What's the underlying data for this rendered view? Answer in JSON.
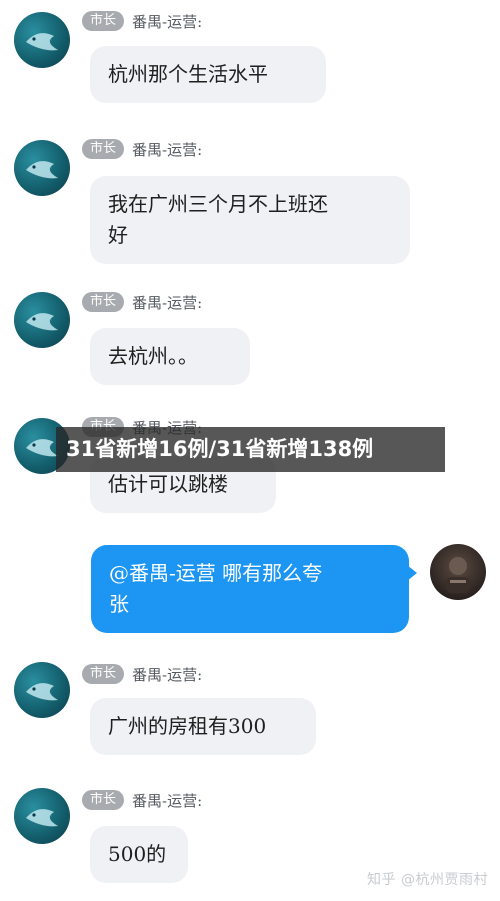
{
  "overlay_headline": "31省新增16例/31省新增138例",
  "watermark": "知乎 @杭州贾雨村",
  "messages": [
    {
      "sender_role": "市长",
      "sender_name": "番禺-运营:",
      "text": "杭州那个生活水平"
    },
    {
      "sender_role": "市长",
      "sender_name": "番禺-运营:",
      "text_lines": [
        "我在广州三个月不上班还",
        "好"
      ]
    },
    {
      "sender_role": "市长",
      "sender_name": "番禺-运营:",
      "text": "去杭州。。"
    },
    {
      "sender_role": "市长",
      "sender_name": "番禺-运营:",
      "text": "估计可以跳楼"
    },
    {
      "text_lines": [
        "@番禺-运营 哪有那么夸",
        "张"
      ]
    },
    {
      "sender_role": "市长",
      "sender_name": "番禺-运营:",
      "text": "广州的房租有300"
    },
    {
      "sender_role": "市长",
      "sender_name": "番禺-运营:",
      "text": "500的"
    }
  ],
  "icons": {
    "avatar_other": "fish-avatar-icon",
    "avatar_me": "photo-avatar-icon"
  },
  "colors": {
    "my_bubble": "#1c96f2",
    "other_bubble": "#eff1f4",
    "badge": "#a7aaae"
  }
}
